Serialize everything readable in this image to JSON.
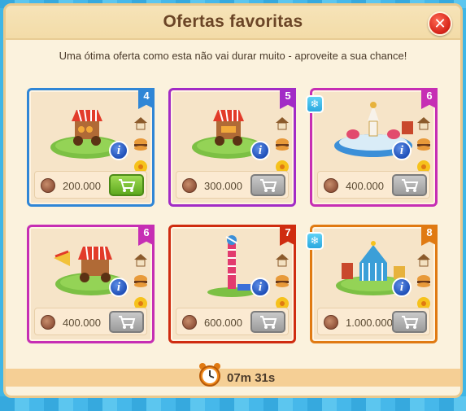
{
  "dialog": {
    "title": "Ofertas favoritas",
    "subtitle": "Uma ótima oferta como esta não vai durar muito - aproveite a sua chance!",
    "close_icon": "close-icon"
  },
  "offers": [
    {
      "level": "4",
      "price": "200.000",
      "color": "#2f86d6",
      "frozen": false,
      "cart_active": true,
      "scene": "market-stall"
    },
    {
      "level": "5",
      "price": "300.000",
      "color": "#a22bc6",
      "frozen": false,
      "cart_active": false,
      "scene": "market-stall"
    },
    {
      "level": "6",
      "price": "400.000",
      "color": "#c62eb4",
      "frozen": true,
      "cart_active": false,
      "scene": "teacup-ride"
    },
    {
      "level": "6",
      "price": "400.000",
      "color": "#c62eb4",
      "frozen": false,
      "cart_active": false,
      "scene": "market-stall"
    },
    {
      "level": "7",
      "price": "600.000",
      "color": "#cf2c10",
      "frozen": false,
      "cart_active": false,
      "scene": "drop-tower"
    },
    {
      "level": "8",
      "price": "1.000.000",
      "color": "#e07a12",
      "frozen": true,
      "cart_active": false,
      "scene": "circus-tent"
    }
  ],
  "timer": {
    "text": "07m 31s",
    "icon": "alarm-clock-icon"
  }
}
